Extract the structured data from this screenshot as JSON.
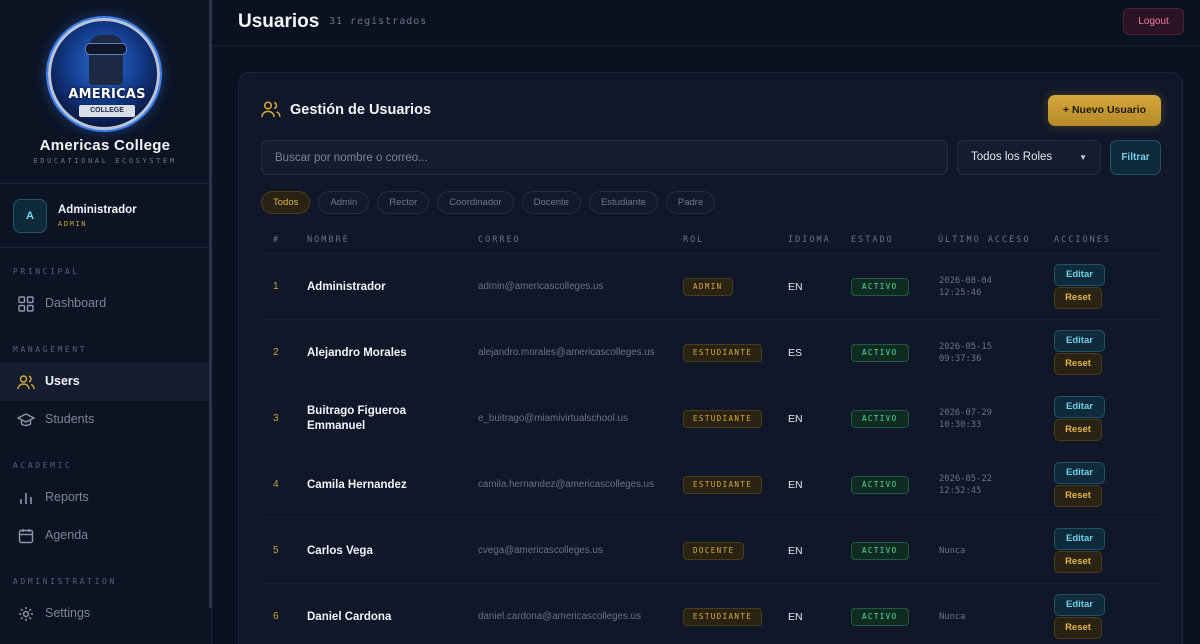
{
  "sidebar": {
    "brand_name": "Americas College",
    "brand_tagline": "EDUCATIONAL ECOSYSTEM",
    "logo_text": "AMERICAS",
    "logo_subtext": "COLLEGE",
    "user": {
      "initial": "A",
      "name": "Administrador",
      "role": "ADMIN"
    },
    "sections": [
      {
        "label": "PRINCIPAL",
        "items": [
          {
            "label": "Dashboard",
            "icon": "grid-icon"
          }
        ]
      },
      {
        "label": "MANAGEMENT",
        "items": [
          {
            "label": "Users",
            "icon": "users-icon",
            "active": true
          },
          {
            "label": "Students",
            "icon": "graduation-cap-icon"
          }
        ]
      },
      {
        "label": "ACADEMIC",
        "items": [
          {
            "label": "Reports",
            "icon": "bar-chart-icon"
          },
          {
            "label": "Agenda",
            "icon": "calendar-icon"
          }
        ]
      },
      {
        "label": "ADMINISTRATION",
        "items": [
          {
            "label": "Settings",
            "icon": "settings-icon"
          }
        ]
      }
    ]
  },
  "header": {
    "title": "Usuarios",
    "count": "31 registrados",
    "logout_label": "Logout"
  },
  "main": {
    "card_title": "Gestión de Usuarios",
    "new_user_label": "+ Nuevo Usuario",
    "search_placeholder": "Buscar por nombre o correo...",
    "role_select_value": "Todos los Roles",
    "filter_label": "Filtrar",
    "chips": [
      "Todos",
      "Admin",
      "Rector",
      "Coordinador",
      "Docente",
      "Estudiante",
      "Padre"
    ],
    "active_chip": "Todos",
    "columns": [
      "#",
      "NOMBRE",
      "CORREO",
      "ROL",
      "IDIOMA",
      "ESTADO",
      "ÚLTIMO ACCESO",
      "ACCIONES"
    ],
    "rows": [
      {
        "num": "1",
        "name": "Administrador",
        "email": "admin@americascolleges.us",
        "role": "ADMIN",
        "lang": "EN",
        "state": "ACTIVO",
        "access": "2026-08-04\n12:25:46",
        "edit": "Editar",
        "reset": "Reset"
      },
      {
        "num": "2",
        "name": "Alejandro Morales",
        "email": "alejandro.morales@americascolleges.us",
        "role": "ESTUDIANTE",
        "lang": "ES",
        "state": "ACTIVO",
        "access": "2026-05-15\n09:37:36",
        "edit": "Editar",
        "reset": "Reset"
      },
      {
        "num": "3",
        "name": "Buitrago Figueroa Emmanuel",
        "email": "e_buitrago@miamivirtualschool.us",
        "role": "ESTUDIANTE",
        "lang": "EN",
        "state": "ACTIVO",
        "access": "2026-07-29\n10:30:33",
        "edit": "Editar",
        "reset": "Reset"
      },
      {
        "num": "4",
        "name": "Camila Hernandez",
        "email": "camila.hernandez@americascolleges.us",
        "role": "ESTUDIANTE",
        "lang": "EN",
        "state": "ACTIVO",
        "access": "2026-05-22\n12:52:45",
        "edit": "Editar",
        "reset": "Reset"
      },
      {
        "num": "5",
        "name": "Carlos Vega",
        "email": "cvega@americascolleges.us",
        "role": "DOCENTE",
        "lang": "EN",
        "state": "ACTIVO",
        "access": "Nunca",
        "edit": "Editar",
        "reset": "Reset"
      },
      {
        "num": "6",
        "name": "Daniel Cardona",
        "email": "daniel.cardona@americascolleges.us",
        "role": "ESTUDIANTE",
        "lang": "EN",
        "state": "ACTIVO",
        "access": "Nunca",
        "edit": "Editar",
        "reset": "Reset"
      }
    ]
  },
  "colors": {
    "accent_gold": "#d4a93d",
    "accent_cyan": "#6fd0e6",
    "status_green": "#4fe09a",
    "logout_pink": "#f07aa0",
    "background": "#0a1120"
  }
}
